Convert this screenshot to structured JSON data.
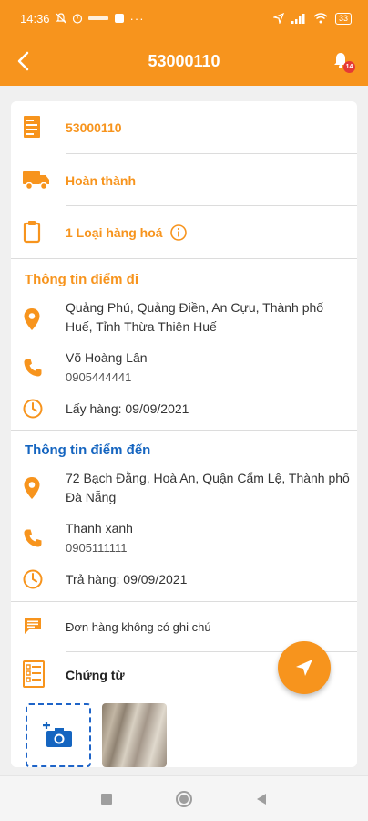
{
  "status_bar": {
    "time": "14:36",
    "battery": "33"
  },
  "appbar": {
    "title": "53000110",
    "notification_count": "14"
  },
  "order": {
    "code": "53000110",
    "status": "Hoàn thành",
    "goods": "1 Loại hàng hoá"
  },
  "origin": {
    "section_title": "Thông tin điểm đi",
    "address": "Quảng Phú, Quảng Điền, An Cựu, Thành phố Huế, Tỉnh Thừa Thiên Huế",
    "contact_name": "Võ Hoàng Lân",
    "phone": "0905444441",
    "pickup": "Lấy hàng: 09/09/2021"
  },
  "destination": {
    "section_title": "Thông tin điểm đến",
    "address": "72 Bạch Đằng, Hoà An, Quận Cẩm Lệ, Thành phố Đà Nẵng",
    "contact_name": "Thanh xanh",
    "phone": "0905111111",
    "delivery": "Trả hàng: 09/09/2021"
  },
  "note": "Đơn hàng không có ghi chú",
  "documents": {
    "label": "Chứng từ"
  },
  "colors": {
    "accent": "#F7941D",
    "blue_heading": "#1565C0",
    "badge": "#e53935",
    "document_icon": "#1565C0"
  },
  "icons": {
    "back": "chevron-left-icon",
    "bell": "bell-icon",
    "receipt": "receipt-icon",
    "truck": "truck-icon",
    "clipboard": "clipboard-icon",
    "info": "info-icon",
    "location": "location-pin-icon",
    "phone": "phone-icon",
    "clock": "clock-icon",
    "comment": "comment-icon",
    "documents": "document-list-icon",
    "add_photo": "add-photo-icon",
    "send": "send-icon"
  }
}
